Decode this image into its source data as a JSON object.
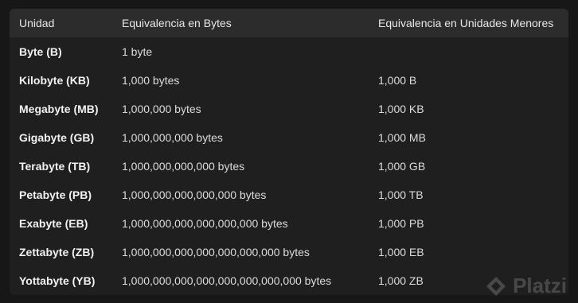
{
  "table": {
    "headers": [
      "Unidad",
      "Equivalencia en Bytes",
      "Equivalencia en Unidades Menores"
    ],
    "rows": [
      [
        "Byte (B)",
        "1 byte",
        ""
      ],
      [
        "Kilobyte (KB)",
        "1,000 bytes",
        "1,000 B"
      ],
      [
        "Megabyte (MB)",
        "1,000,000 bytes",
        "1,000 KB"
      ],
      [
        "Gigabyte (GB)",
        "1,000,000,000 bytes",
        "1,000 MB"
      ],
      [
        "Terabyte (TB)",
        "1,000,000,000,000 bytes",
        "1,000 GB"
      ],
      [
        "Petabyte (PB)",
        "1,000,000,000,000,000 bytes",
        "1,000 TB"
      ],
      [
        "Exabyte (EB)",
        "1,000,000,000,000,000,000 bytes",
        "1,000 PB"
      ],
      [
        "Zettabyte (ZB)",
        "1,000,000,000,000,000,000,000 bytes",
        "1,000 EB"
      ],
      [
        "Yottabyte (YB)",
        "1,000,000,000,000,000,000,000,000 bytes",
        "1,000 ZB"
      ]
    ]
  },
  "watermark": {
    "text": "Platzi",
    "icon": "platzi-logo-icon"
  },
  "colors": {
    "background": "#171717",
    "table_background": "#1f1f1f",
    "header_background": "#2c2c2c",
    "text": "#e6e6e6"
  }
}
